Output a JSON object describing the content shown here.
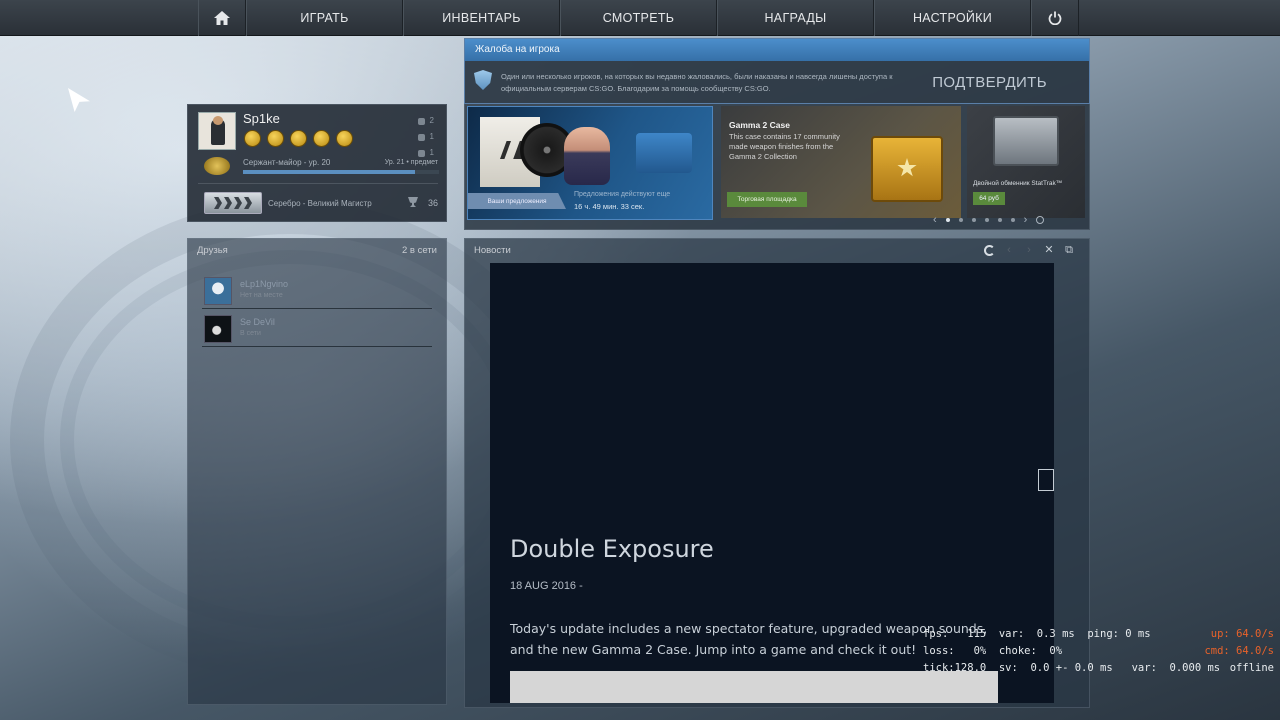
{
  "nav": {
    "home_icon": "home-icon",
    "play": "ИГРАТЬ",
    "inventory": "ИНВЕНТАРЬ",
    "watch": "СМОТРЕТЬ",
    "awards": "НАГРАДЫ",
    "settings": "НАСТРОЙКИ",
    "power_icon": "power-icon"
  },
  "profile": {
    "nickname": "Sp1ke",
    "rank": "Сержант-майор - ур. 20",
    "next_level": "Ур. 21 • предмет",
    "xp_progress": 0.88,
    "stats": [
      "2",
      "1",
      "1"
    ],
    "skill_group": "Серебро - Великий Магистр",
    "trophies": "36"
  },
  "friends": {
    "title": "Друзья",
    "online": "2 в сети",
    "list": [
      {
        "name": "eLp1Ngvino",
        "status": "Нет на месте"
      },
      {
        "name": "Se DeVil",
        "status": "В сети"
      }
    ]
  },
  "report": {
    "title": "Жалоба на игрока",
    "text": "Один или несколько игроков, на которых вы недавно жаловались, были наказаны и навсегда лишены доступа к официальным серверам CS:GO. Благодарим за помощь сообществу CS:GO.",
    "confirm": "ПОДТВЕРДИТЬ"
  },
  "store": {
    "offer_button": "Ваши предложения",
    "offer_text": "Предложения действуют еще",
    "offer_time": "16 ч. 49 мин. 33 сек.",
    "case_title": "Gamma 2 Case",
    "case_desc": "This case contains 17 community made weapon finishes from the Gamma 2 Collection",
    "market_button": "Торговая площадка",
    "kit_title": "Двойной обменник StatTrak™",
    "kit_price": "64 руб",
    "prev": "‹",
    "next": "›"
  },
  "news": {
    "title": "Новости",
    "headline": "Double Exposure",
    "date": "18 AUG 2016 -",
    "body": "Today's update includes a new spectator feature, upgraded weapon sounds, and the new Gamma 2 Case. Jump into a game and check it out!"
  },
  "netgraph": {
    "line1": "fps:   115  var:  0.3 ms  ping: 0 ms",
    "line2": "loss:   0%  choke:  0%",
    "line3": "tick:128.0  sv:  0.0 +- 0.0 ms   var:  0.000 ms",
    "up": "up: 64.0/s",
    "cmd": "cmd: 64.0/s",
    "status": "offline",
    "up_color": "#e8622a"
  }
}
